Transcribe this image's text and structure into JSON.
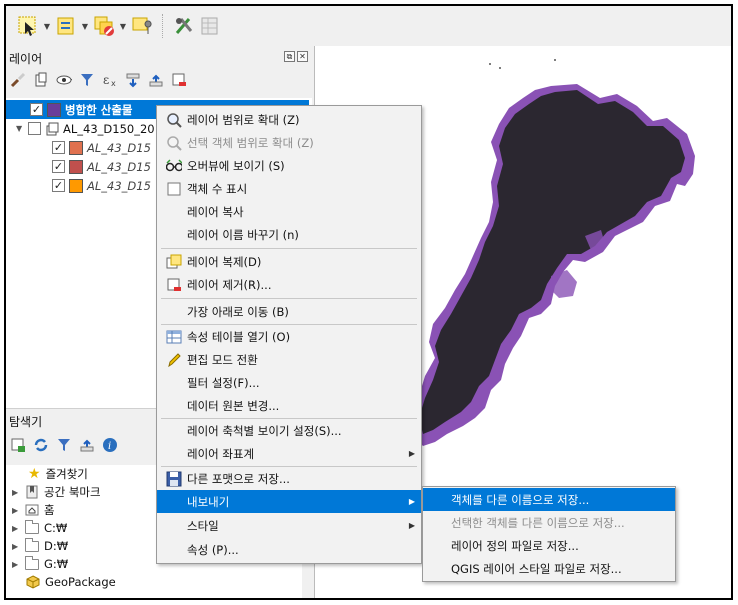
{
  "layers_panel": {
    "title": "레이어",
    "tree": [
      {
        "label": "병합한 산출물",
        "checked": true,
        "color": "#6a3d9a"
      },
      {
        "label": "AL_43_D150_20",
        "checked": false
      },
      {
        "label": "AL_43_D15",
        "checked": true,
        "color": "#e0714f"
      },
      {
        "label": "AL_43_D15",
        "checked": true,
        "color": "#c0504d"
      },
      {
        "label": "AL_43_D15",
        "checked": true,
        "color": "#ff9900"
      }
    ]
  },
  "browser_panel": {
    "title": "탐색기",
    "items": [
      "즐겨찾기",
      "공간 북마크",
      "홈",
      "C:₩",
      "D:₩",
      "G:₩",
      "GeoPackage"
    ]
  },
  "context_menu": {
    "items": [
      {
        "label": "레이어 범위로 확대 (Z)",
        "icon": "zoom-layer-icon"
      },
      {
        "label": "선택 객체 범위로 확대 (Z)",
        "icon": "zoom-selection-icon",
        "disabled": true
      },
      {
        "label": "오버뷰에 보이기 (S)",
        "icon": "overview-icon"
      },
      {
        "label": "객체 수 표시",
        "icon": "checkbox-icon"
      },
      {
        "label": "레이어 복사"
      },
      {
        "label": "레이어 이름 바꾸기 (n)"
      },
      {
        "label": "레이어 복제(D)",
        "icon": "duplicate-icon"
      },
      {
        "label": "레이어 제거(R)...",
        "icon": "remove-layer-icon"
      },
      {
        "label": "가장 아래로 이동 (B)"
      },
      {
        "label": "속성 테이블 열기 (O)",
        "icon": "table-icon"
      },
      {
        "label": "편집 모드 전환",
        "icon": "pencil-icon"
      },
      {
        "label": "필터 설정(F)..."
      },
      {
        "label": "데이터 원본 변경..."
      },
      {
        "label": "레이어 축척별 보이기 설정(S)..."
      },
      {
        "label": "레이어 좌표계",
        "submenu": true
      },
      {
        "label": "다른 포맷으로 저장...",
        "icon": "save-icon"
      },
      {
        "label": "내보내기",
        "submenu": true,
        "highlighted": true
      },
      {
        "label": "스타일",
        "submenu": true
      },
      {
        "label": "속성 (P)..."
      }
    ]
  },
  "export_submenu": {
    "items": [
      {
        "label": "객체를 다른 이름으로 저장...",
        "highlighted": true
      },
      {
        "label": "선택한 객체를 다른 이름으로 저장...",
        "disabled": true
      },
      {
        "label": "레이어 정의 파일로 저장..."
      },
      {
        "label": "QGIS 레이어 스타일 파일로 저장..."
      }
    ]
  },
  "colors": {
    "highlight": "#0078d7",
    "map_dark": "#2b2730",
    "map_purple": "#8a52b5"
  }
}
